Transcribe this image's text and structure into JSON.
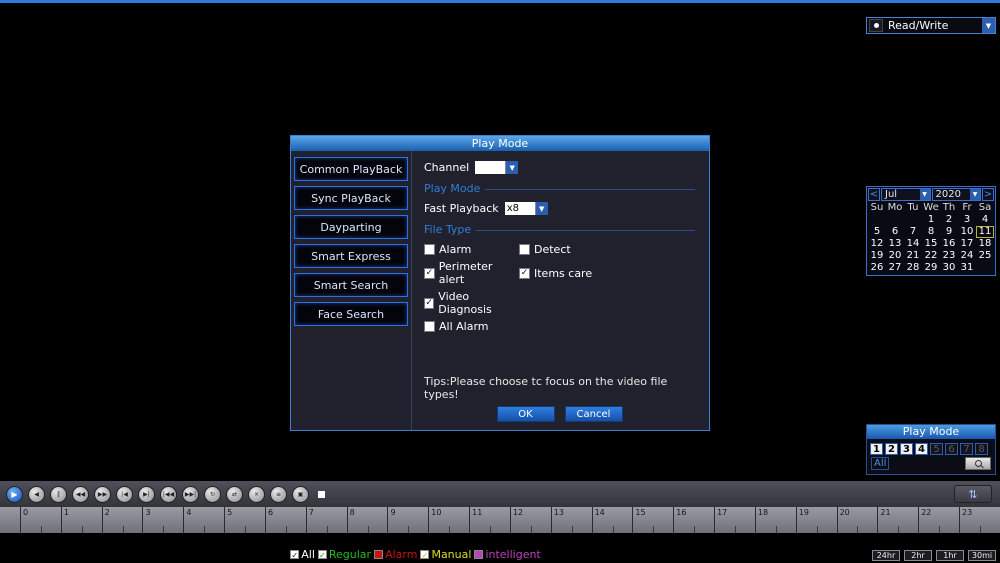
{
  "icons": {
    "dropdown_arrow": "▼",
    "updown": "⇅"
  },
  "mode_selector": {
    "label": "Read/Write"
  },
  "dialog": {
    "title": "Play Mode",
    "sidebar": [
      {
        "label": "Common PlayBack"
      },
      {
        "label": "Sync PlayBack"
      },
      {
        "label": "Dayparting"
      },
      {
        "label": "Smart Express"
      },
      {
        "label": "Smart Search"
      },
      {
        "label": "Face Search"
      }
    ],
    "channel": {
      "label": "Channel",
      "value": ""
    },
    "play_mode_section": "Play Mode",
    "fast_playback": {
      "label": "Fast Playback",
      "value": "x8"
    },
    "file_type_section": "File Type",
    "file_type_rows": [
      [
        {
          "label": "Alarm",
          "checked": false
        },
        {
          "label": "Detect",
          "checked": false
        }
      ],
      [
        {
          "label": "Perimeter alert",
          "checked": true
        },
        {
          "label": "Items care",
          "checked": true
        }
      ],
      [
        {
          "label": "Video Diagnosis",
          "checked": true
        }
      ],
      [
        {
          "label": "All Alarm",
          "checked": false
        }
      ]
    ],
    "tips": "Tips:Please choose tc focus on the video file types!",
    "ok_label": "OK",
    "cancel_label": "Cancel"
  },
  "calendar": {
    "prev": "<",
    "next": ">",
    "month": "Jul",
    "year": "2020",
    "day_headers": [
      "Su",
      "Mo",
      "Tu",
      "We",
      "Th",
      "Fr",
      "Sa"
    ],
    "weeks": [
      [
        "",
        "",
        "",
        "1",
        "2",
        "3",
        "4"
      ],
      [
        "5",
        "6",
        "7",
        "8",
        "9",
        "10",
        "11"
      ],
      [
        "12",
        "13",
        "14",
        "15",
        "16",
        "17",
        "18"
      ],
      [
        "19",
        "20",
        "21",
        "22",
        "23",
        "24",
        "25"
      ],
      [
        "26",
        "27",
        "28",
        "29",
        "30",
        "31",
        ""
      ]
    ],
    "selected_day": "11"
  },
  "channel_panel": {
    "title": "Play Mode",
    "channels": [
      {
        "label": "1",
        "active": true
      },
      {
        "label": "2",
        "active": true
      },
      {
        "label": "3",
        "active": true
      },
      {
        "label": "4",
        "active": true
      },
      {
        "label": "5",
        "active": false
      },
      {
        "label": "6",
        "active": false
      },
      {
        "label": "7",
        "active": false
      },
      {
        "label": "8",
        "active": false
      }
    ],
    "all_label": "All"
  },
  "controls": {
    "buttons": [
      {
        "name": "play",
        "glyph": "▶",
        "accent": true
      },
      {
        "name": "reverse-play",
        "glyph": "◀",
        "accent": false
      },
      {
        "name": "pause",
        "glyph": "‖",
        "accent": false
      },
      {
        "name": "rewind",
        "glyph": "◀◀",
        "accent": false
      },
      {
        "name": "fast-forward",
        "glyph": "▶▶",
        "accent": false
      },
      {
        "name": "prev-frame",
        "glyph": "|◀",
        "accent": false
      },
      {
        "name": "next-frame",
        "glyph": "▶|",
        "accent": false
      },
      {
        "name": "prev-file",
        "glyph": "|◀◀",
        "accent": false
      },
      {
        "name": "next-file",
        "glyph": "▶▶|",
        "accent": false
      },
      {
        "name": "loop",
        "glyph": "↻",
        "accent": false
      },
      {
        "name": "shuffle",
        "glyph": "⇄",
        "accent": false
      },
      {
        "name": "mute",
        "glyph": "×",
        "accent": false
      },
      {
        "name": "playlist",
        "glyph": "≡",
        "accent": false
      },
      {
        "name": "snapshot",
        "glyph": "▣",
        "accent": false
      }
    ]
  },
  "timeline": {
    "hours": [
      "0",
      "1",
      "2",
      "3",
      "4",
      "5",
      "6",
      "7",
      "8",
      "9",
      "10",
      "11",
      "12",
      "13",
      "14",
      "15",
      "16",
      "17",
      "18",
      "19",
      "20",
      "21",
      "22",
      "23"
    ]
  },
  "legend": {
    "items": [
      {
        "label": "All",
        "color": "#ffffff",
        "check_color": "#111111",
        "checked": true
      },
      {
        "label": "Regular",
        "color": "#22bb22",
        "check_color": "#119911",
        "checked": true
      },
      {
        "label": "Alarm",
        "color": "#cc1111",
        "check_color": "#cc1111",
        "checked": false
      },
      {
        "label": "Manual",
        "color": "#dddd22",
        "check_color": "#bbbb11",
        "checked": true
      },
      {
        "label": "intelligent",
        "color": "#bb44bb",
        "check_color": "#bb44bb",
        "checked": false
      }
    ]
  },
  "range_buttons": [
    {
      "label": "24hr"
    },
    {
      "label": "2hr"
    },
    {
      "label": "1hr"
    },
    {
      "label": "30mi"
    }
  ]
}
